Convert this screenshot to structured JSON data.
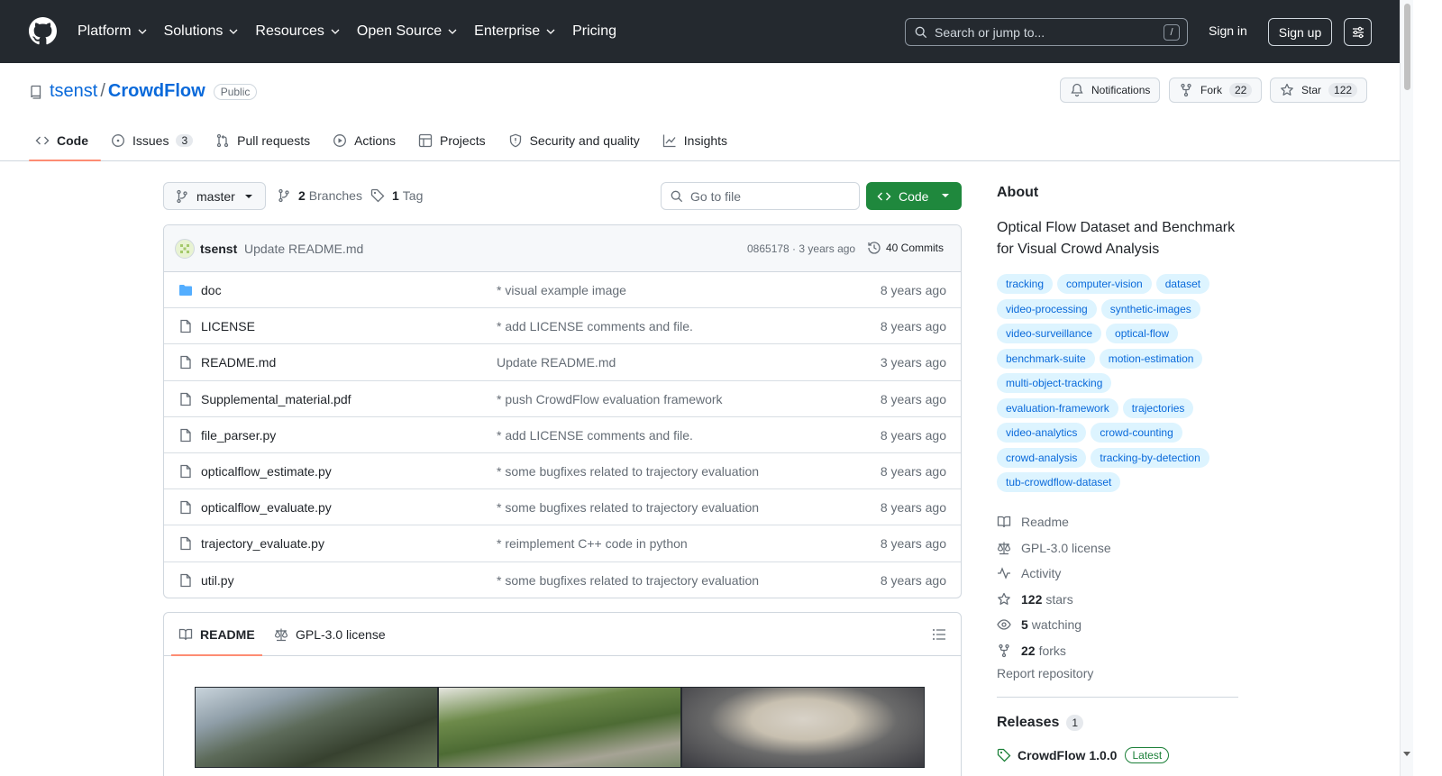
{
  "header": {
    "nav": [
      {
        "label": "Platform",
        "has_menu": true
      },
      {
        "label": "Solutions",
        "has_menu": true
      },
      {
        "label": "Resources",
        "has_menu": true
      },
      {
        "label": "Open Source",
        "has_menu": true
      },
      {
        "label": "Enterprise",
        "has_menu": true
      },
      {
        "label": "Pricing",
        "has_menu": false
      }
    ],
    "search_placeholder": "Search or jump to...",
    "search_shortcut": "/",
    "sign_in": "Sign in",
    "sign_up": "Sign up"
  },
  "repo": {
    "owner": "tsenst",
    "separator": "/",
    "name": "CrowdFlow",
    "visibility": "Public",
    "notifications_label": "Notifications",
    "fork_label": "Fork",
    "fork_count": "22",
    "star_label": "Star",
    "star_count": "122"
  },
  "tabs": {
    "code": "Code",
    "issues": "Issues",
    "issues_count": "3",
    "pull_requests": "Pull requests",
    "actions": "Actions",
    "projects": "Projects",
    "security": "Security and quality",
    "insights": "Insights"
  },
  "toolbar": {
    "branch": "master",
    "branches_count": "2",
    "branches_label": "Branches",
    "tags_count": "1",
    "tags_label": "Tag",
    "goto_file_placeholder": "Go to file",
    "code_button": "Code"
  },
  "commit": {
    "author": "tsenst",
    "message": "Update README.md",
    "meta": "0865178 · 3 years ago",
    "commits_label": "40 Commits"
  },
  "files": [
    {
      "name": "doc",
      "type": "folder",
      "message": "* visual example image",
      "age": "8 years ago"
    },
    {
      "name": "LICENSE",
      "type": "file",
      "message": "* add LICENSE comments and file.",
      "age": "8 years ago"
    },
    {
      "name": "README.md",
      "type": "file",
      "message": "Update README.md",
      "age": "3 years ago"
    },
    {
      "name": "Supplemental_material.pdf",
      "type": "file",
      "message": "* push CrowdFlow evaluation framework",
      "age": "8 years ago"
    },
    {
      "name": "file_parser.py",
      "type": "file",
      "message": "* add LICENSE comments and file.",
      "age": "8 years ago"
    },
    {
      "name": "opticalflow_estimate.py",
      "type": "file",
      "message": "* some bugfixes related to trajectory evaluation",
      "age": "8 years ago"
    },
    {
      "name": "opticalflow_evaluate.py",
      "type": "file",
      "message": "* some bugfixes related to trajectory evaluation",
      "age": "8 years ago"
    },
    {
      "name": "trajectory_evaluate.py",
      "type": "file",
      "message": "* reimplement C++ code in python",
      "age": "8 years ago"
    },
    {
      "name": "util.py",
      "type": "file",
      "message": "* some bugfixes related to trajectory evaluation",
      "age": "8 years ago"
    }
  ],
  "readme": {
    "tab_readme": "README",
    "tab_license": "GPL-3.0 license"
  },
  "about": {
    "heading": "About",
    "description": "Optical Flow Dataset and Benchmark for Visual Crowd Analysis",
    "topics": [
      "tracking",
      "computer-vision",
      "dataset",
      "video-processing",
      "synthetic-images",
      "video-surveillance",
      "optical-flow",
      "benchmark-suite",
      "motion-estimation",
      "multi-object-tracking",
      "evaluation-framework",
      "trajectories",
      "video-analytics",
      "crowd-counting",
      "crowd-analysis",
      "tracking-by-detection",
      "tub-crowdflow-dataset"
    ],
    "readme_link": "Readme",
    "license_link": "GPL-3.0 license",
    "activity_link": "Activity",
    "stars_count": "122",
    "stars_label": "stars",
    "watching_count": "5",
    "watching_label": "watching",
    "forks_count": "22",
    "forks_label": "forks",
    "report": "Report repository"
  },
  "releases": {
    "heading": "Releases",
    "count": "1",
    "latest_name": "CrowdFlow 1.0.0",
    "latest_badge": "Latest"
  }
}
